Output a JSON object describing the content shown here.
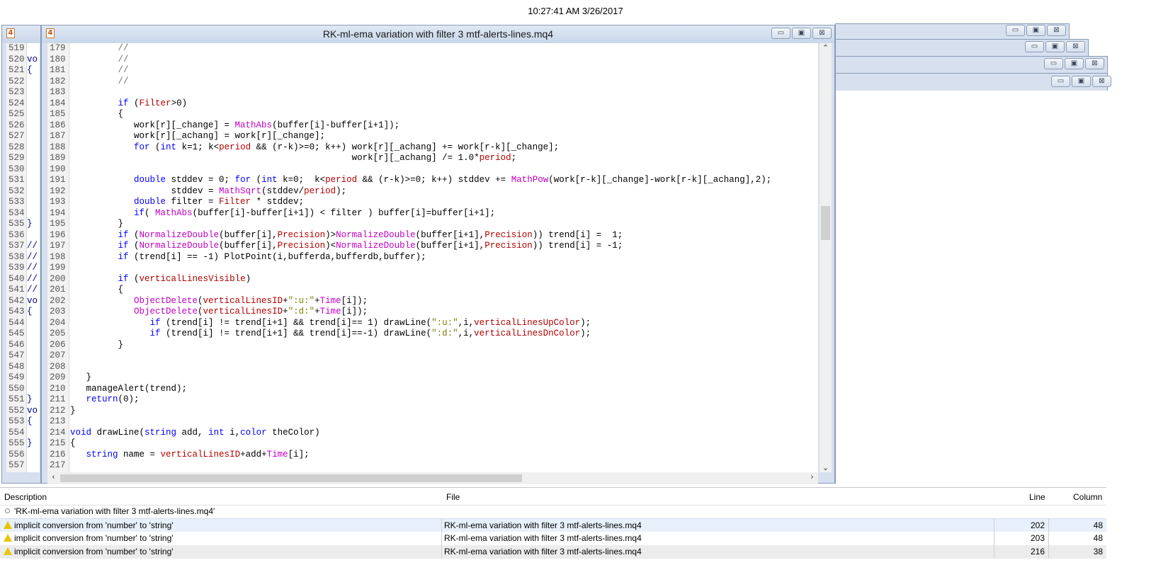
{
  "clock": "10:27:41 AM 3/26/2017",
  "main_window": {
    "title": "RK-ml-ema variation with filter 3 mtf-alerts-lines.mq4",
    "icon": "mq4-file-icon",
    "btn_min": "▭",
    "btn_max": "▣",
    "btn_close": "⊠"
  },
  "left_editor": {
    "icon": "mq4-file-icon",
    "lines": [
      "519",
      "520",
      "521",
      "522",
      "523",
      "524",
      "525",
      "526",
      "527",
      "528",
      "529",
      "530",
      "531",
      "532",
      "533",
      "534",
      "535",
      "536",
      "537",
      "538",
      "539",
      "540",
      "541",
      "542",
      "543",
      "544",
      "545",
      "546",
      "547",
      "548",
      "549",
      "550",
      "551",
      "552",
      "553",
      "554",
      "555",
      "556",
      "557"
    ],
    "code": [
      "",
      "vo",
      "{",
      "",
      "",
      "",
      "",
      "",
      "",
      "",
      "",
      "",
      "",
      "",
      "",
      "",
      "}",
      "",
      "//",
      "//",
      "//",
      "//",
      "//",
      "vo",
      "{",
      "",
      "",
      "",
      "",
      "",
      "",
      "",
      "}",
      "vo",
      "{",
      "",
      "}",
      "",
      ""
    ]
  },
  "editor": {
    "lines": [
      {
        "n": "179",
        "code": "         //"
      },
      {
        "n": "180",
        "code": "         //"
      },
      {
        "n": "181",
        "code": "         //"
      },
      {
        "n": "182",
        "code": "         //"
      },
      {
        "n": "183",
        "code": ""
      },
      {
        "n": "184",
        "code": "         if (Filter>0)"
      },
      {
        "n": "185",
        "code": "         {"
      },
      {
        "n": "186",
        "code": "            work[r][_change] = MathAbs(buffer[i]-buffer[i+1]);"
      },
      {
        "n": "187",
        "code": "            work[r][_achang] = work[r][_change];"
      },
      {
        "n": "188",
        "code": "            for (int k=1; k<period && (r-k)>=0; k++) work[r][_achang] += work[r-k][_change];"
      },
      {
        "n": "189",
        "code": "                                                     work[r][_achang] /= 1.0*period;"
      },
      {
        "n": "190",
        "code": ""
      },
      {
        "n": "191",
        "code": "            double stddev = 0; for (int k=0;  k<period && (r-k)>=0; k++) stddev += MathPow(work[r-k][_change]-work[r-k][_achang],2);"
      },
      {
        "n": "192",
        "code": "                   stddev = MathSqrt(stddev/period);"
      },
      {
        "n": "193",
        "code": "            double filter = Filter * stddev;"
      },
      {
        "n": "194",
        "code": "            if( MathAbs(buffer[i]-buffer[i+1]) < filter ) buffer[i]=buffer[i+1];"
      },
      {
        "n": "195",
        "code": "         }"
      },
      {
        "n": "196",
        "code": "         if (NormalizeDouble(buffer[i],Precision)>NormalizeDouble(buffer[i+1],Precision)) trend[i] =  1;"
      },
      {
        "n": "197",
        "code": "         if (NormalizeDouble(buffer[i],Precision)<NormalizeDouble(buffer[i+1],Precision)) trend[i] = -1;"
      },
      {
        "n": "198",
        "code": "         if (trend[i] == -1) PlotPoint(i,bufferda,bufferdb,buffer);"
      },
      {
        "n": "199",
        "code": ""
      },
      {
        "n": "200",
        "code": "         if (verticalLinesVisible)"
      },
      {
        "n": "201",
        "code": "         {"
      },
      {
        "n": "202",
        "code": "            ObjectDelete(verticalLinesID+\":u:\"+Time[i]);"
      },
      {
        "n": "203",
        "code": "            ObjectDelete(verticalLinesID+\":d:\"+Time[i]);"
      },
      {
        "n": "204",
        "code": "               if (trend[i] != trend[i+1] && trend[i]== 1) drawLine(\":u:\",i,verticalLinesUpColor);"
      },
      {
        "n": "205",
        "code": "               if (trend[i] != trend[i+1] && trend[i]==-1) drawLine(\":d:\",i,verticalLinesDnColor);"
      },
      {
        "n": "206",
        "code": "         }"
      },
      {
        "n": "207",
        "code": ""
      },
      {
        "n": "208",
        "code": ""
      },
      {
        "n": "209",
        "code": "   }"
      },
      {
        "n": "210",
        "code": "   manageAlert(trend);"
      },
      {
        "n": "211",
        "code": "   return(0);"
      },
      {
        "n": "212",
        "code": "}"
      },
      {
        "n": "213",
        "code": ""
      },
      {
        "n": "214",
        "code": "void drawLine(string add, int i,color theColor)"
      },
      {
        "n": "215",
        "code": "{"
      },
      {
        "n": "216",
        "code": "   string name = verticalLinesID+add+Time[i];"
      },
      {
        "n": "217",
        "code": ""
      }
    ]
  },
  "problems": {
    "headers": {
      "description": "Description",
      "file": "File",
      "line": "Line",
      "column": "Column"
    },
    "header_row": "'RK-ml-ema variation with filter 3 mtf-alerts-lines.mq4'",
    "rows": [
      {
        "description": "implicit conversion from 'number' to 'string'",
        "file": "RK-ml-ema variation with filter 3 mtf-alerts-lines.mq4",
        "line": "202",
        "column": "48"
      },
      {
        "description": "implicit conversion from 'number' to 'string'",
        "file": "RK-ml-ema variation with filter 3 mtf-alerts-lines.mq4",
        "line": "203",
        "column": "48"
      },
      {
        "description": "implicit conversion from 'number' to 'string'",
        "file": "RK-ml-ema variation with filter 3 mtf-alerts-lines.mq4",
        "line": "216",
        "column": "38"
      }
    ]
  }
}
